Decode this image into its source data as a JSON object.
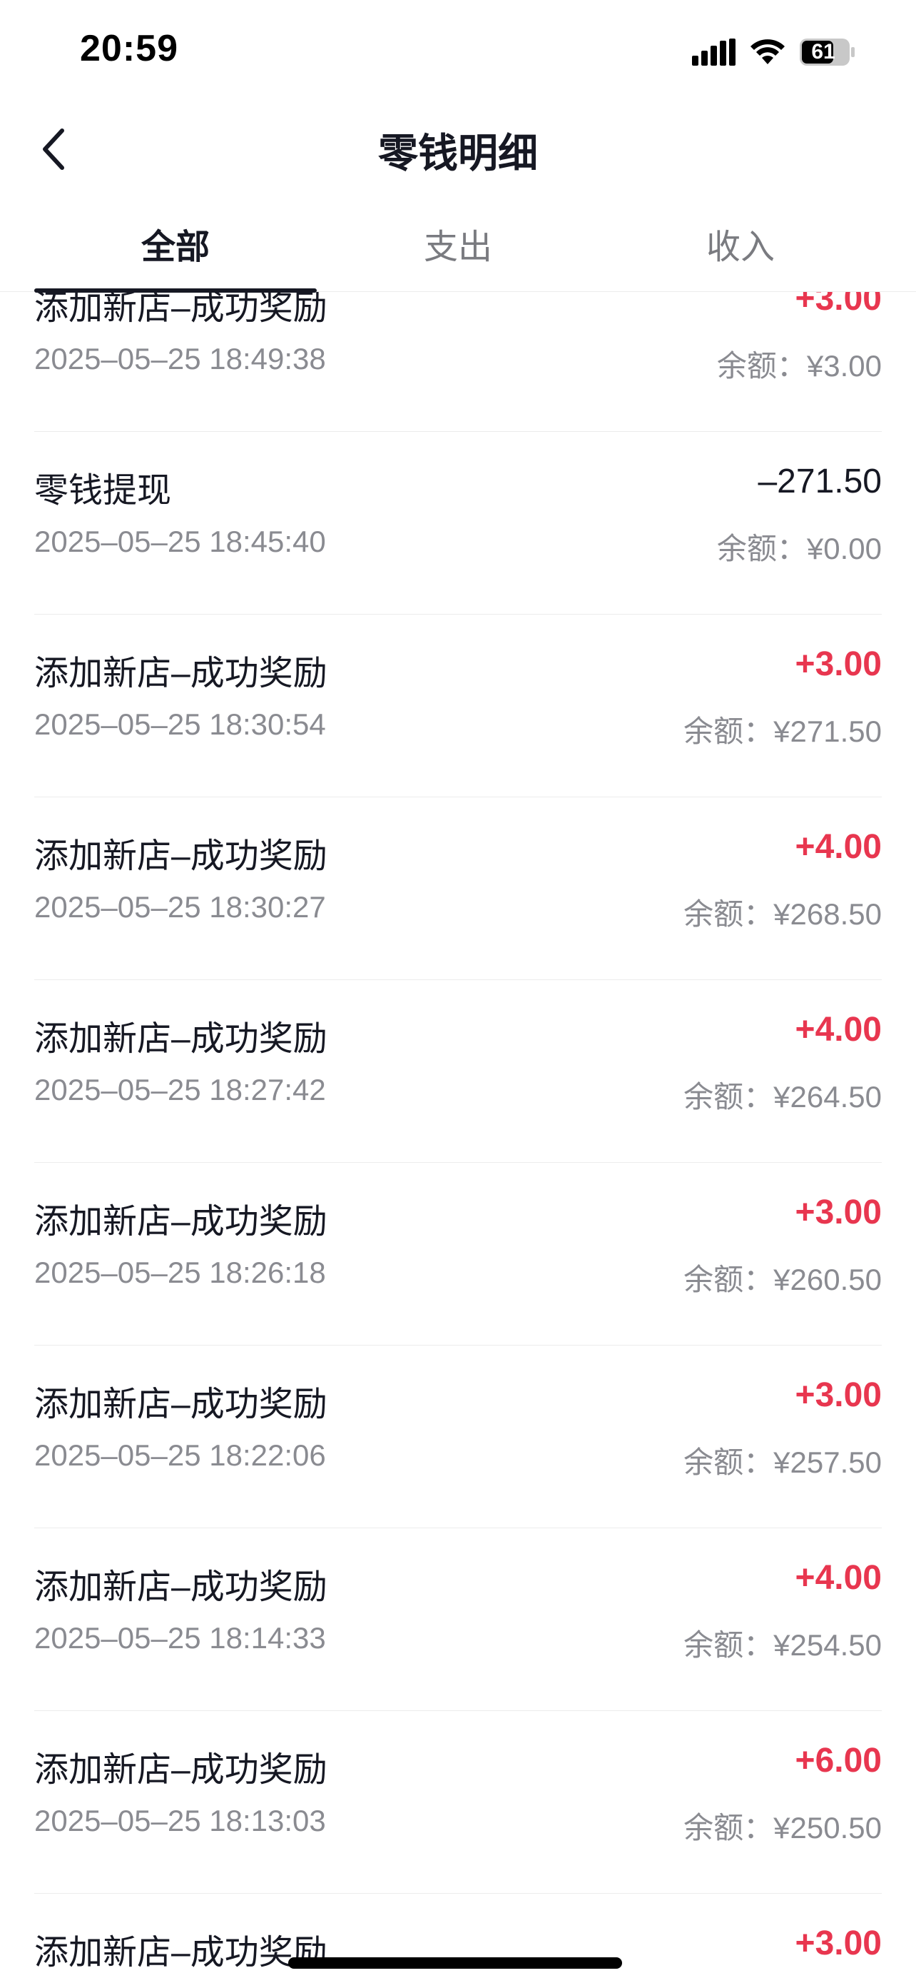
{
  "status_bar": {
    "time": "20:59",
    "battery": "61"
  },
  "nav": {
    "title": "零钱明细"
  },
  "tabs": [
    {
      "label": "全部",
      "active": true
    },
    {
      "label": "支出",
      "active": false
    },
    {
      "label": "收入",
      "active": false
    }
  ],
  "colors": {
    "income": "#e8364f",
    "text": "#161823",
    "secondary": "#8a8b91"
  },
  "transactions": [
    {
      "title": "添加新店–成功奖励",
      "amount": "+3.00",
      "time": "2025–05–25 18:49:38",
      "balance": "余额：¥3.00"
    },
    {
      "title": "零钱提现",
      "amount": "–271.50",
      "time": "2025–05–25 18:45:40",
      "balance": "余额：¥0.00"
    },
    {
      "title": "添加新店–成功奖励",
      "amount": "+3.00",
      "time": "2025–05–25 18:30:54",
      "balance": "余额：¥271.50"
    },
    {
      "title": "添加新店–成功奖励",
      "amount": "+4.00",
      "time": "2025–05–25 18:30:27",
      "balance": "余额：¥268.50"
    },
    {
      "title": "添加新店–成功奖励",
      "amount": "+4.00",
      "time": "2025–05–25 18:27:42",
      "balance": "余额：¥264.50"
    },
    {
      "title": "添加新店–成功奖励",
      "amount": "+3.00",
      "time": "2025–05–25 18:26:18",
      "balance": "余额：¥260.50"
    },
    {
      "title": "添加新店–成功奖励",
      "amount": "+3.00",
      "time": "2025–05–25 18:22:06",
      "balance": "余额：¥257.50"
    },
    {
      "title": "添加新店–成功奖励",
      "amount": "+4.00",
      "time": "2025–05–25 18:14:33",
      "balance": "余额：¥254.50"
    },
    {
      "title": "添加新店–成功奖励",
      "amount": "+6.00",
      "time": "2025–05–25 18:13:03",
      "balance": "余额：¥250.50"
    },
    {
      "title": "添加新店–成功奖励",
      "amount": "+3.00",
      "time": "",
      "balance": ""
    }
  ]
}
